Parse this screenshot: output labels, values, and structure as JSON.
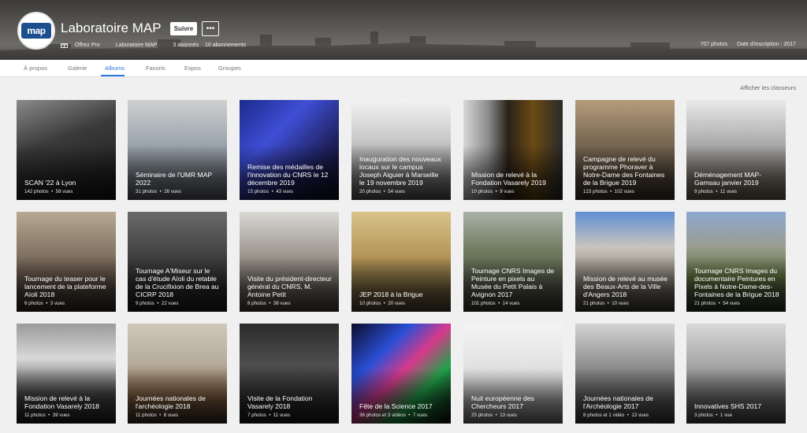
{
  "profile": {
    "avatar_text": "map",
    "name": "Laboratoire MAP",
    "follow_label": "Suivre",
    "more_label": "•••",
    "pro_label": "Offrez Pro",
    "real_name": "Laboratoire MAP",
    "followers": "3 abonnés",
    "following": "10 abonnements",
    "photo_count": "707 photos",
    "joined": "Date d'inscription : 2017"
  },
  "tabs": [
    {
      "label": "À propos"
    },
    {
      "label": "Galerie"
    },
    {
      "label": "Albums"
    },
    {
      "label": "Favoris"
    },
    {
      "label": "Expos"
    },
    {
      "label": "Groupes"
    }
  ],
  "active_tab": "Albums",
  "classeurs_link": "Afficher les classeurs",
  "albums": [
    {
      "title": "SCAN '22 à Lyon",
      "photos": "142 photos",
      "views": "58 vues"
    },
    {
      "title": "Séminaire de l'UMR MAP 2022",
      "photos": "31 photos",
      "views": "26 vues"
    },
    {
      "title": "Remise des médailles de l'innovation du CNRS le 12 décembre 2019",
      "photos": "15 photos",
      "views": "43 vues"
    },
    {
      "title": "Inauguration des nouveaux locaux sur le campus Joseph Aiguier à Marseille le 19 novembre 2019",
      "photos": "20 photos",
      "views": "54 vues"
    },
    {
      "title": "Mission de relevé à la Fondation Vasarely 2019",
      "photos": "10 photos",
      "views": "9 vues"
    },
    {
      "title": "Campagne de relevé du programme Phoraver à Notre-Dame des Fontaines de la Brigue 2019",
      "photos": "123 photos",
      "views": "102 vues"
    },
    {
      "title": "Déménagement MAP-Gamsau janvier 2019",
      "photos": "9 photos",
      "views": "11 vues"
    },
    {
      "title": "Tournage du teaser pour le lancement de la plateforme Aïoli 2018",
      "photos": "6 photos",
      "views": "3 vues"
    },
    {
      "title": "Tournage A'Miseur sur le cas d'étude Aïoli du retable de la Crucifixion de Brea au CICRP 2018",
      "photos": "9 photos",
      "views": "22 vues"
    },
    {
      "title": "Visite du président-directeur général du CNRS, M. Antoine Petit",
      "photos": "8 photos",
      "views": "38 vues"
    },
    {
      "title": "JEP 2018 à la Brigue",
      "photos": "10 photos",
      "views": "20 vues"
    },
    {
      "title": "Tournage CNRS Images de Peinture en pixels au Musée du Petit Palais à Avignon 2017",
      "photos": "101 photos",
      "views": "14 vues"
    },
    {
      "title": "Mission de relevé au musée des Beaux-Arts de la Ville d'Angers 2018",
      "photos": "21 photos",
      "views": "10 vues"
    },
    {
      "title": "Tournage CNRS Images du documentaire Peintures en Pixels à Notre-Dame-des-Fontaines de la Brigue 2018",
      "photos": "21 photos",
      "views": "54 vues"
    },
    {
      "title": "Mission de relevé à la Fondation Vasarely 2018",
      "photos": "11 photos",
      "views": "39 vues"
    },
    {
      "title": "Journées nationales de l'archéologie 2018",
      "photos": "11 photos",
      "views": "8 vues"
    },
    {
      "title": "Visite de la Fondation Vasarely 2018",
      "photos": "7 photos",
      "views": "11 vues"
    },
    {
      "title": "Fête de la Science 2017",
      "photos": "36 photos et 3 vidéos",
      "views": "7 vues"
    },
    {
      "title": "Nuit européenne des Chercheurs 2017",
      "photos": "25 photos",
      "views": "13 vues"
    },
    {
      "title": "Journées nationales de l'Archéologie 2017",
      "photos": "8 photos et 1 vidéo",
      "views": "13 vues"
    },
    {
      "title": "Innovatives SHS 2017",
      "photos": "3 photos",
      "views": "1 vue"
    }
  ],
  "colors": {
    "accent": "#2a7ad8",
    "header_bg": "#4a4845",
    "page_bg": "#f0f0f0"
  }
}
